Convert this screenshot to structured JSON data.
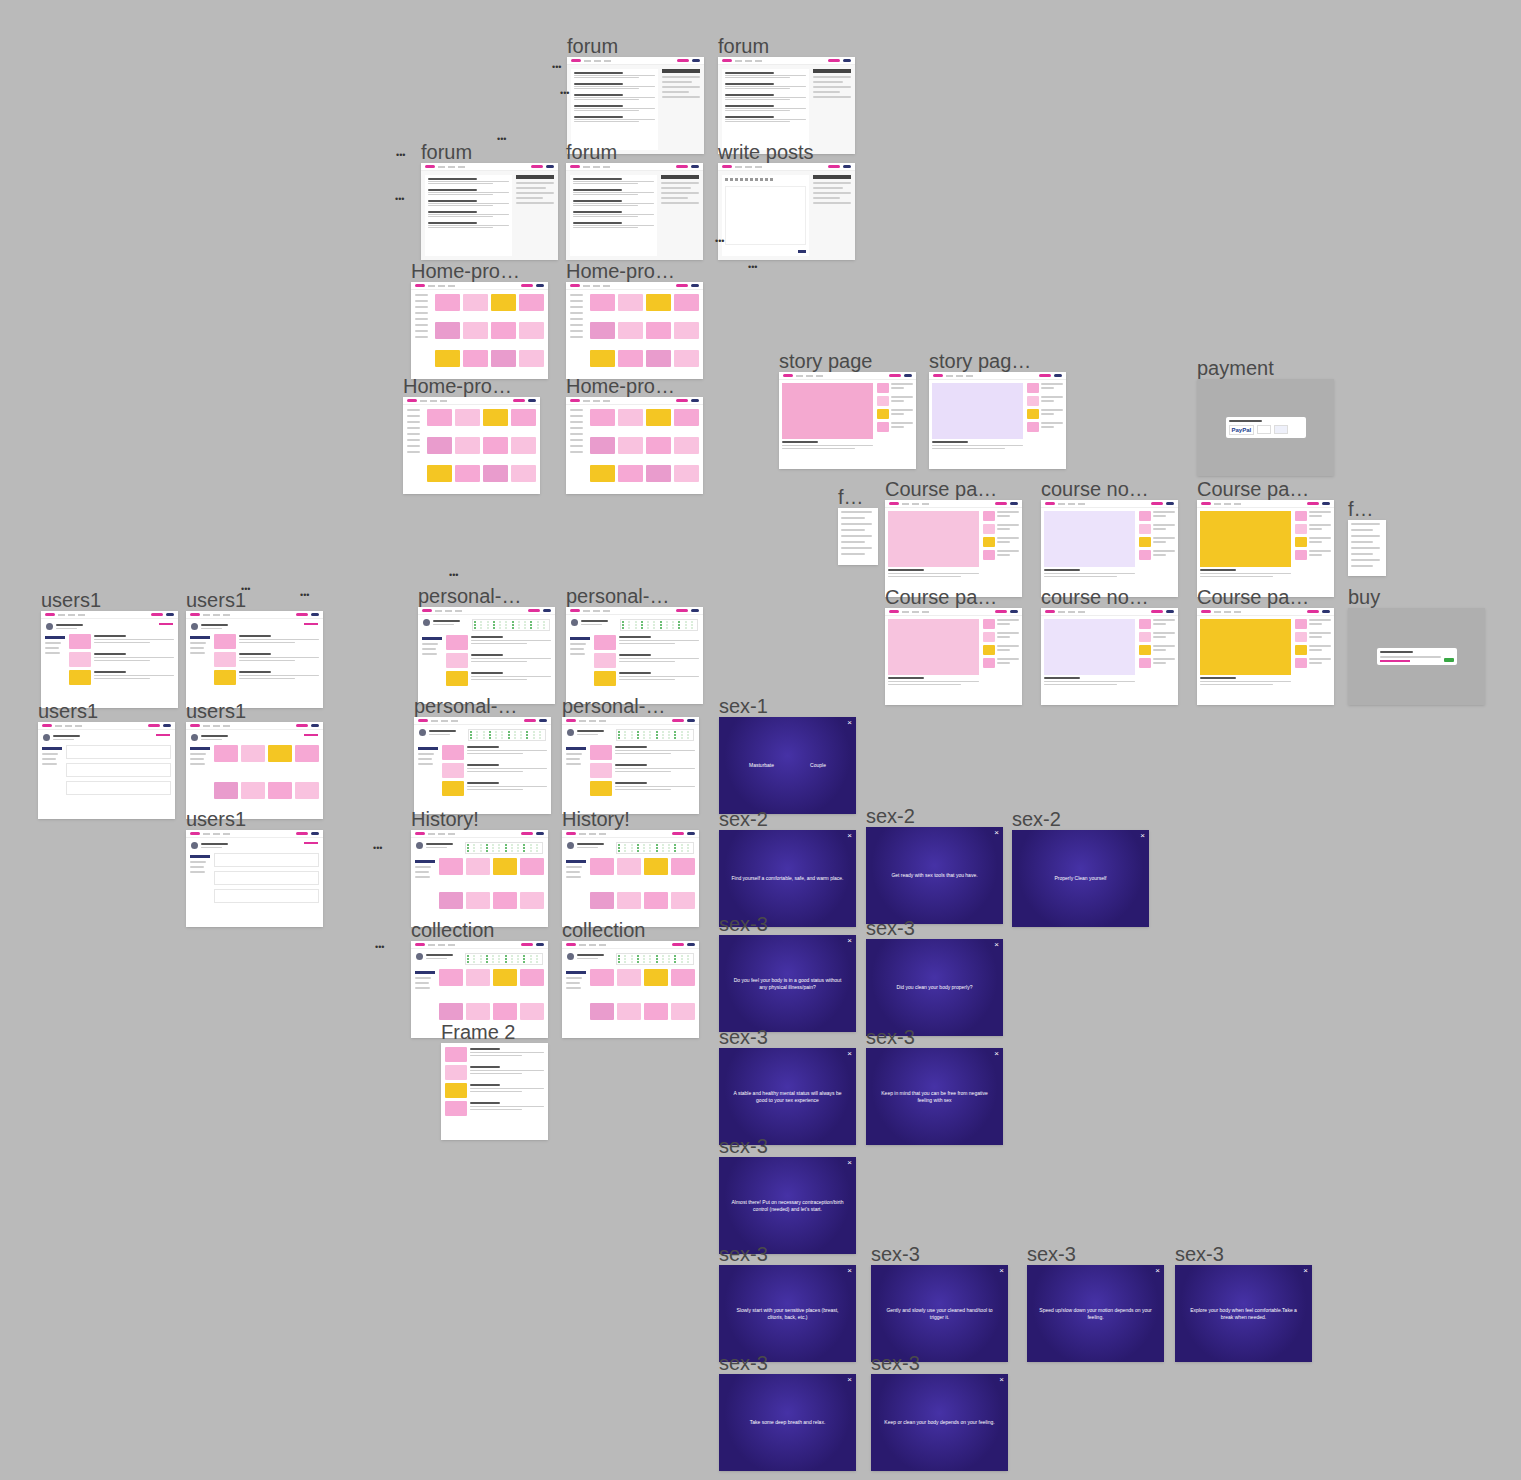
{
  "canvas": {
    "name": "design-canvas"
  },
  "frames": [
    {
      "label": "forum",
      "kind": "forum"
    },
    {
      "label": "forum",
      "kind": "forum"
    },
    {
      "label": "forum",
      "kind": "forum"
    },
    {
      "label": "forum",
      "kind": "forum"
    },
    {
      "label": "write posts",
      "kind": "write"
    },
    {
      "label": "Home-pro…",
      "kind": "home"
    },
    {
      "label": "Home-pro…",
      "kind": "home"
    },
    {
      "label": "Home-pro…",
      "kind": "home"
    },
    {
      "label": "Home-pro…",
      "kind": "home"
    },
    {
      "label": "story page",
      "kind": "story",
      "color": "#f4a9d0"
    },
    {
      "label": "story pag…",
      "kind": "story",
      "color": "#e9defa"
    },
    {
      "label": "payment",
      "kind": "payment",
      "badge": "PayPal"
    },
    {
      "label": "f…",
      "kind": "mini"
    },
    {
      "label": "Course pa…",
      "kind": "course",
      "color": "#f7c3de"
    },
    {
      "label": "course no…",
      "kind": "course",
      "color": "#ece3fb"
    },
    {
      "label": "Course pa…",
      "kind": "course",
      "color": "#f4c623"
    },
    {
      "label": "f…",
      "kind": "mini"
    },
    {
      "label": "Course pa…",
      "kind": "course",
      "color": "#f7c3de"
    },
    {
      "label": "course no…",
      "kind": "course",
      "color": "#ece3fb"
    },
    {
      "label": "Course pa…",
      "kind": "course",
      "color": "#f4c623"
    },
    {
      "label": "buy",
      "kind": "buy"
    },
    {
      "label": "users1",
      "kind": "users-list"
    },
    {
      "label": "users1",
      "kind": "users-list"
    },
    {
      "label": "users1",
      "kind": "users-form"
    },
    {
      "label": "users1",
      "kind": "users-grid"
    },
    {
      "label": "users1",
      "kind": "users-form"
    },
    {
      "label": "personal-…",
      "kind": "personal"
    },
    {
      "label": "personal-…",
      "kind": "personal"
    },
    {
      "label": "personal-…",
      "kind": "personal"
    },
    {
      "label": "personal-…",
      "kind": "personal"
    },
    {
      "label": "History!",
      "kind": "history"
    },
    {
      "label": "History!",
      "kind": "history"
    },
    {
      "label": "collection",
      "kind": "collection"
    },
    {
      "label": "collection",
      "kind": "collection"
    },
    {
      "label": "Frame 2",
      "kind": "list"
    },
    {
      "label": "sex-1",
      "kind": "sex-choice",
      "close": "×",
      "options": [
        "Masturbate",
        "Couple"
      ]
    },
    {
      "label": "sex-2",
      "kind": "sex",
      "close": "×",
      "text": "Find yourself a comfortable, safe, and warm place."
    },
    {
      "label": "sex-2",
      "kind": "sex",
      "close": "×",
      "text": "Get ready with sex tools that you have."
    },
    {
      "label": "sex-2",
      "kind": "sex",
      "close": "×",
      "text": "Properly Clean yourself"
    },
    {
      "label": "sex-3",
      "kind": "sex",
      "close": "×",
      "text": "Do you feel your body is in a good status without any physical illness/pain?"
    },
    {
      "label": "sex-3",
      "kind": "sex",
      "close": "×",
      "text": "Did you clean your body properly?"
    },
    {
      "label": "sex-3",
      "kind": "sex",
      "close": "×",
      "text": "A stable and healthy mental status will always be good to your sex experience"
    },
    {
      "label": "sex-3",
      "kind": "sex",
      "close": "×",
      "text": "Keep in mind that you can be free from negative feeling with sex"
    },
    {
      "label": "sex-3",
      "kind": "sex",
      "close": "×",
      "text": "Almost there! Put on necessary contraception/birth control (needed) and let's start."
    },
    {
      "label": "sex-3",
      "kind": "sex",
      "close": "×",
      "text": "Slowly start with your sensitive places (breast, clitoris, back, etc.)"
    },
    {
      "label": "sex-3",
      "kind": "sex",
      "close": "×",
      "text": "Gently and slowly use your cleaned hand/tool to trigger it."
    },
    {
      "label": "sex-3",
      "kind": "sex",
      "close": "×",
      "text": "Speed up/slow down your motion depends on your feeling."
    },
    {
      "label": "sex-3",
      "kind": "sex",
      "close": "×",
      "text": "Explore your body when feel comfortable.Take a break when needed."
    },
    {
      "label": "sex-3",
      "kind": "sex",
      "close": "×",
      "text": "Take some deep breath and relax."
    },
    {
      "label": "sex-3",
      "kind": "sex",
      "close": "×",
      "text": "Keep or clean your body depends on your feeling."
    }
  ],
  "markers": [
    "•••",
    "•••",
    "•••",
    "•••",
    "•••",
    "•••",
    "•••",
    "•••",
    "•••",
    "•••",
    "•••",
    "•••"
  ]
}
